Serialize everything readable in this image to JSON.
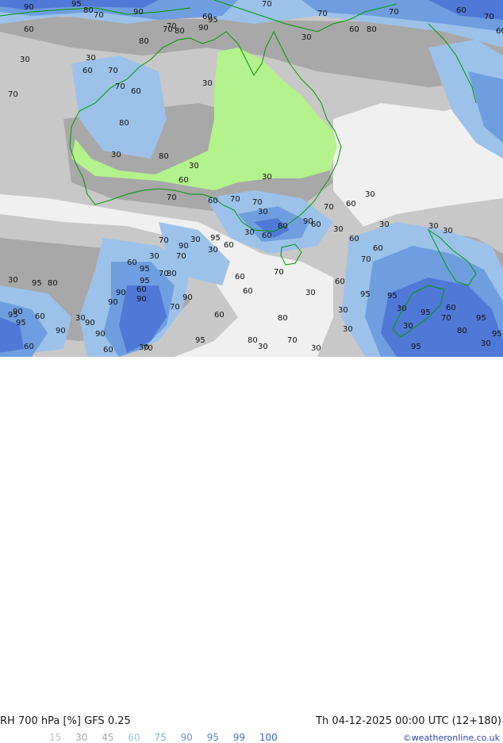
{
  "map": {
    "contour_labels": [
      {
        "v": "90",
        "c": "#111"
      },
      {
        "v": "95",
        "c": "#111"
      },
      {
        "v": "80",
        "c": "#111"
      },
      {
        "v": "70",
        "c": "#111"
      },
      {
        "v": "90",
        "c": "#111"
      },
      {
        "v": "70",
        "c": "#111"
      },
      {
        "v": "80",
        "c": "#111"
      },
      {
        "v": "90",
        "c": "#111"
      },
      {
        "v": "95",
        "c": "#111"
      },
      {
        "v": "80",
        "c": "#111"
      },
      {
        "v": "60",
        "c": "#111"
      },
      {
        "v": "70",
        "c": "#111"
      },
      {
        "v": "70",
        "c": "#111"
      },
      {
        "v": "60",
        "c": "#111"
      },
      {
        "v": "80",
        "c": "#111"
      },
      {
        "v": "30",
        "c": "#111"
      },
      {
        "v": "70",
        "c": "#111"
      },
      {
        "v": "60",
        "c": "#111"
      },
      {
        "v": "70",
        "c": "#111"
      },
      {
        "v": "60",
        "c": "#111"
      },
      {
        "v": "30",
        "c": "#111"
      },
      {
        "v": "30",
        "c": "#111"
      },
      {
        "v": "60",
        "c": "#111"
      },
      {
        "v": "70",
        "c": "#111"
      },
      {
        "v": "60",
        "c": "#111"
      },
      {
        "v": "70",
        "c": "#111"
      },
      {
        "v": "80",
        "c": "#111"
      },
      {
        "v": "30",
        "c": "#111"
      },
      {
        "v": "70",
        "c": "#111"
      },
      {
        "v": "80",
        "c": "#111"
      },
      {
        "v": "30",
        "c": "#111"
      },
      {
        "v": "60",
        "c": "#111"
      },
      {
        "v": "70",
        "c": "#111"
      },
      {
        "v": "30",
        "c": "#111"
      },
      {
        "v": "60",
        "c": "#111"
      },
      {
        "v": "70",
        "c": "#111"
      },
      {
        "v": "70",
        "c": "#111"
      },
      {
        "v": "30",
        "c": "#111"
      },
      {
        "v": "30",
        "c": "#111"
      },
      {
        "v": "70",
        "c": "#111"
      },
      {
        "v": "60",
        "c": "#111"
      },
      {
        "v": "30",
        "c": "#111"
      },
      {
        "v": "60",
        "c": "#111"
      },
      {
        "v": "30",
        "c": "#111"
      },
      {
        "v": "60",
        "c": "#111"
      },
      {
        "v": "70",
        "c": "#111"
      },
      {
        "v": "60",
        "c": "#111"
      },
      {
        "v": "30",
        "c": "#111"
      },
      {
        "v": "30",
        "c": "#111"
      },
      {
        "v": "30",
        "c": "#111"
      },
      {
        "v": "70",
        "c": "#111"
      },
      {
        "v": "60",
        "c": "#111"
      },
      {
        "v": "70",
        "c": "#111"
      },
      {
        "v": "30",
        "c": "#111"
      },
      {
        "v": "30",
        "c": "#111"
      },
      {
        "v": "30",
        "c": "#111"
      },
      {
        "v": "60",
        "c": "#111"
      },
      {
        "v": "60",
        "c": "#111"
      },
      {
        "v": "30",
        "c": "#111"
      },
      {
        "v": "70",
        "c": "#111"
      },
      {
        "v": "60",
        "c": "#111"
      },
      {
        "v": "95",
        "c": "#111"
      },
      {
        "v": "80",
        "c": "#111"
      },
      {
        "v": "70",
        "c": "#111"
      },
      {
        "v": "30",
        "c": "#111"
      },
      {
        "v": "95",
        "c": "#111"
      },
      {
        "v": "90",
        "c": "#111"
      },
      {
        "v": "60",
        "c": "#111"
      },
      {
        "v": "30",
        "c": "#111"
      },
      {
        "v": "70",
        "c": "#111"
      },
      {
        "v": "60",
        "c": "#111"
      },
      {
        "v": "80",
        "c": "#111"
      },
      {
        "v": "30",
        "c": "#111"
      },
      {
        "v": "80",
        "c": "#111"
      },
      {
        "v": "70",
        "c": "#111"
      },
      {
        "v": "80",
        "c": "#111"
      },
      {
        "v": "90",
        "c": "#111"
      },
      {
        "v": "30",
        "c": "#111"
      },
      {
        "v": "60",
        "c": "#111"
      },
      {
        "v": "95",
        "c": "#111"
      },
      {
        "v": "95",
        "c": "#111"
      },
      {
        "v": "90",
        "c": "#111"
      },
      {
        "v": "60",
        "c": "#111"
      },
      {
        "v": "30",
        "c": "#111"
      },
      {
        "v": "95",
        "c": "#111"
      },
      {
        "v": "80",
        "c": "#111"
      },
      {
        "v": "60",
        "c": "#111"
      },
      {
        "v": "30",
        "c": "#111"
      },
      {
        "v": "90",
        "c": "#111"
      },
      {
        "v": "90",
        "c": "#111"
      },
      {
        "v": "60",
        "c": "#111"
      },
      {
        "v": "90",
        "c": "#111"
      },
      {
        "v": "30",
        "c": "#111"
      },
      {
        "v": "90",
        "c": "#111"
      },
      {
        "v": "60",
        "c": "#111"
      },
      {
        "v": "95",
        "c": "#111"
      },
      {
        "v": "90",
        "c": "#111"
      },
      {
        "v": "90",
        "c": "#111"
      },
      {
        "v": "70",
        "c": "#111"
      },
      {
        "v": "90",
        "c": "#111"
      },
      {
        "v": "95",
        "c": "#111"
      },
      {
        "v": "70",
        "c": "#111"
      },
      {
        "v": "60",
        "c": "#111"
      },
      {
        "v": "30",
        "c": "#111"
      },
      {
        "v": "95",
        "c": "#111"
      },
      {
        "v": "95",
        "c": "#111"
      },
      {
        "v": "30",
        "c": "#111"
      },
      {
        "v": "30",
        "c": "#111"
      },
      {
        "v": "95",
        "c": "#111"
      },
      {
        "v": "95",
        "c": "#111"
      },
      {
        "v": "60",
        "c": "#111"
      },
      {
        "v": "70",
        "c": "#111"
      },
      {
        "v": "80",
        "c": "#111"
      },
      {
        "v": "30",
        "c": "#111"
      },
      {
        "v": "95",
        "c": "#111"
      },
      {
        "v": "95",
        "c": "#111"
      }
    ],
    "colors": {
      "ocean_light": "#f0f0f0",
      "gray_30": "#c8c8c8",
      "gray_45": "#a8a8a8",
      "green_15": "#b4f28c",
      "blue_60": "#9cc2ea",
      "blue_75": "#6f9ee0",
      "blue_90": "#5078d6",
      "coast": "#009900"
    }
  },
  "footer": {
    "title": "RH 700 hPa [%] GFS 0.25",
    "run": "Th 04-12-2025 00:00 UTC (12+180)",
    "legend": [
      {
        "v": "15",
        "c": "#c0c0c0"
      },
      {
        "v": "30",
        "c": "#a8a8a8"
      },
      {
        "v": "45",
        "c": "#a8a8a8"
      },
      {
        "v": "60",
        "c": "#9cc2ea"
      },
      {
        "v": "75",
        "c": "#7fa8e4"
      },
      {
        "v": "90",
        "c": "#6a92dc"
      },
      {
        "v": "95",
        "c": "#5a82d8"
      },
      {
        "v": "99",
        "c": "#4a70d0"
      },
      {
        "v": "100",
        "c": "#3a60c8"
      }
    ],
    "credit": "©weatheronline.co.uk"
  }
}
